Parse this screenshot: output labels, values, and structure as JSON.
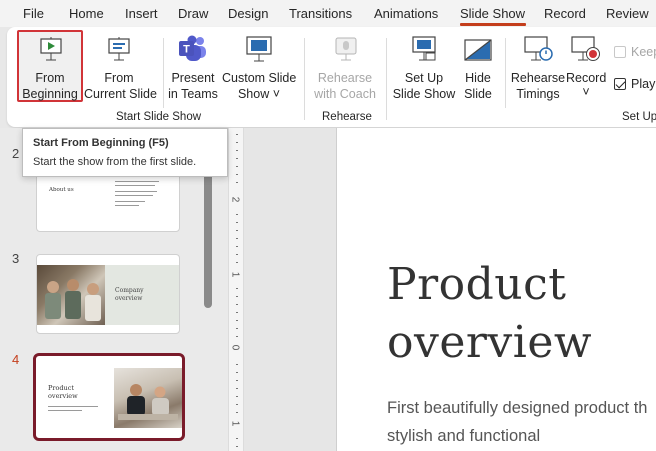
{
  "tabs": [
    "File",
    "Home",
    "Insert",
    "Draw",
    "Design",
    "Transitions",
    "Animations",
    "Slide Show",
    "Record",
    "Review"
  ],
  "active_tab": "Slide Show",
  "ribbon": {
    "from_beginning": {
      "line1": "From",
      "line2": "Beginning"
    },
    "from_current": {
      "line1": "From",
      "line2": "Current Slide"
    },
    "present_teams": {
      "line1": "Present",
      "line2": "in Teams"
    },
    "custom_show": {
      "line1": "Custom Slide",
      "line2": "Show ˅"
    },
    "rehearse_coach": {
      "line1": "Rehearse",
      "line2": "with Coach"
    },
    "setup_show": {
      "line1": "Set Up",
      "line2": "Slide Show"
    },
    "hide_slide": {
      "line1": "Hide",
      "line2": "Slide"
    },
    "rehearse_timings": {
      "line1": "Rehearse",
      "line2": "Timings"
    },
    "record": {
      "line1": "Record",
      "line2": "˅"
    },
    "keep_label": "Keep",
    "play_label": "Play",
    "groups": {
      "start": "Start Slide Show",
      "rehearse": "Rehearse",
      "setup": "Set Up"
    }
  },
  "tooltip": {
    "title": "Start From Beginning (F5)",
    "description": "Start the show from the first slide."
  },
  "thumbnails": {
    "slide2": {
      "number": "2",
      "title": "About us"
    },
    "slide3": {
      "number": "3",
      "title_line1": "Company",
      "title_line2": "overview"
    },
    "slide4": {
      "number": "4",
      "title_line1": "Product",
      "title_line2": "overview"
    }
  },
  "ruler": {
    "labels": [
      "2",
      "1",
      "0",
      "1"
    ]
  },
  "slide": {
    "title_line1": "Product",
    "title_line2": "overview",
    "body_line1": "First beautifully designed product th",
    "body_line2": "stylish and functional"
  },
  "colors": {
    "accent": "#c43e1c",
    "highlight_border": "#d13438",
    "selected_thumb": "#7a1b2a"
  }
}
